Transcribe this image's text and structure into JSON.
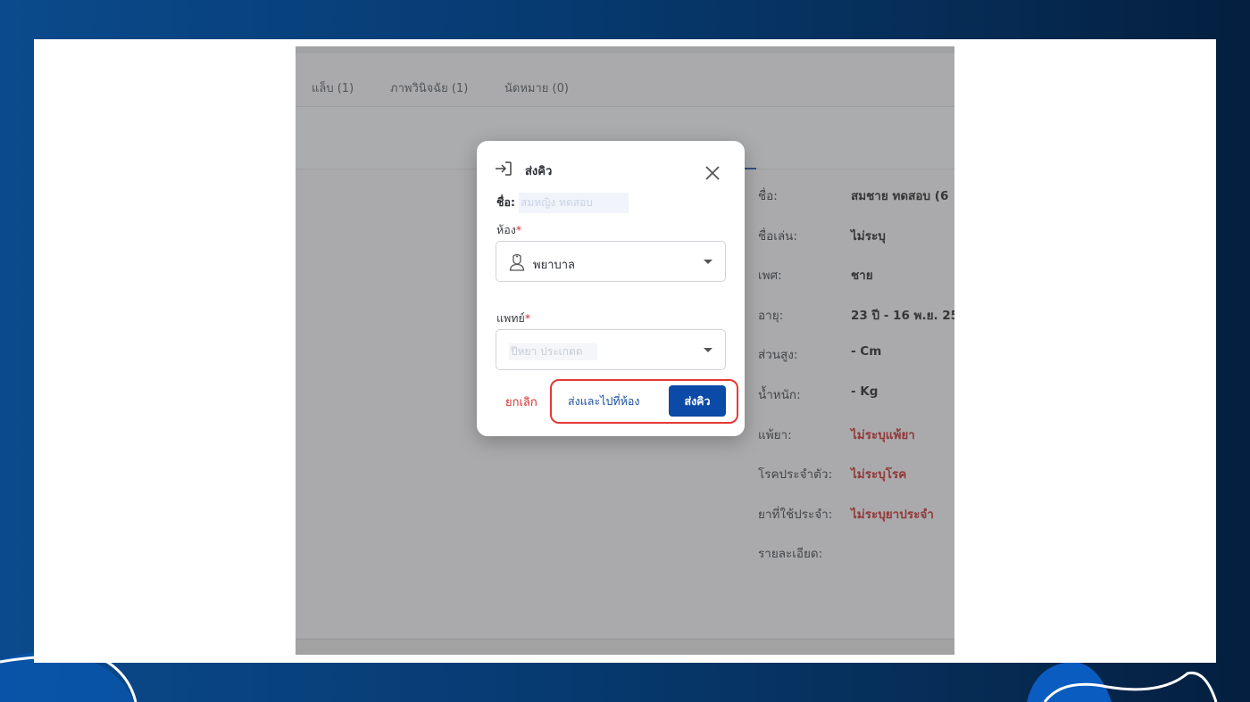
{
  "colors": {
    "background_left": "#0b4a8c",
    "background_right": "#041f3f",
    "primary": "#0b4aa6",
    "danger": "#d32f2f",
    "highlight": "#e53935"
  },
  "tabs": [
    {
      "label": "แล็บ (1)"
    },
    {
      "label": "ภาพวินิจฉัย (1)"
    },
    {
      "label": "นัดหมาย (0)"
    }
  ],
  "patient_info": [
    {
      "label": "ชื่อ:",
      "value": "สมชาย ทดสอบ  (6",
      "highlight": false
    },
    {
      "label": "ชื่อเล่น:",
      "value": "ไม่ระบุ",
      "highlight": false
    },
    {
      "label": "เพศ:",
      "value": "ชาย",
      "highlight": false
    },
    {
      "label": "อายุ:",
      "value": "23 ปี - 16 พ.ย. 25",
      "highlight": false
    },
    {
      "label": "ส่วนสูง:",
      "value": "- Cm",
      "highlight": false
    },
    {
      "label": "น้ำหนัก:",
      "value": "- Kg",
      "highlight": false
    },
    {
      "label": "แพ้ยา:",
      "value": "ไม่ระบุแพ้ยา",
      "highlight": true
    },
    {
      "label": "โรคประจำตัว:",
      "value": "ไม่ระบุโรค",
      "highlight": true
    },
    {
      "label": "ยาที่ใช้ประจำ:",
      "value": "ไม่ระบุยาประจำ",
      "highlight": true
    },
    {
      "label": "รายละเอียด:",
      "value": "",
      "highlight": false
    }
  ],
  "modal": {
    "title": "ส่งคิว",
    "title_icon": "sign-in-icon",
    "name_label": "ชื่อ:",
    "name_value": "สมหญิง ทดสอบ",
    "room": {
      "label": "ห้อง",
      "required_mark": "*",
      "value": "พยาบาล",
      "icon": "nurse-icon"
    },
    "doctor": {
      "label": "แพทย์",
      "required_mark": "*",
      "placeholder": "ปีหยา ประเกตต"
    },
    "cancel_label": "ยกเลิก",
    "send_and_go_label": "ส่งและไปที่ห้อง",
    "send_label": "ส่งคิว"
  }
}
